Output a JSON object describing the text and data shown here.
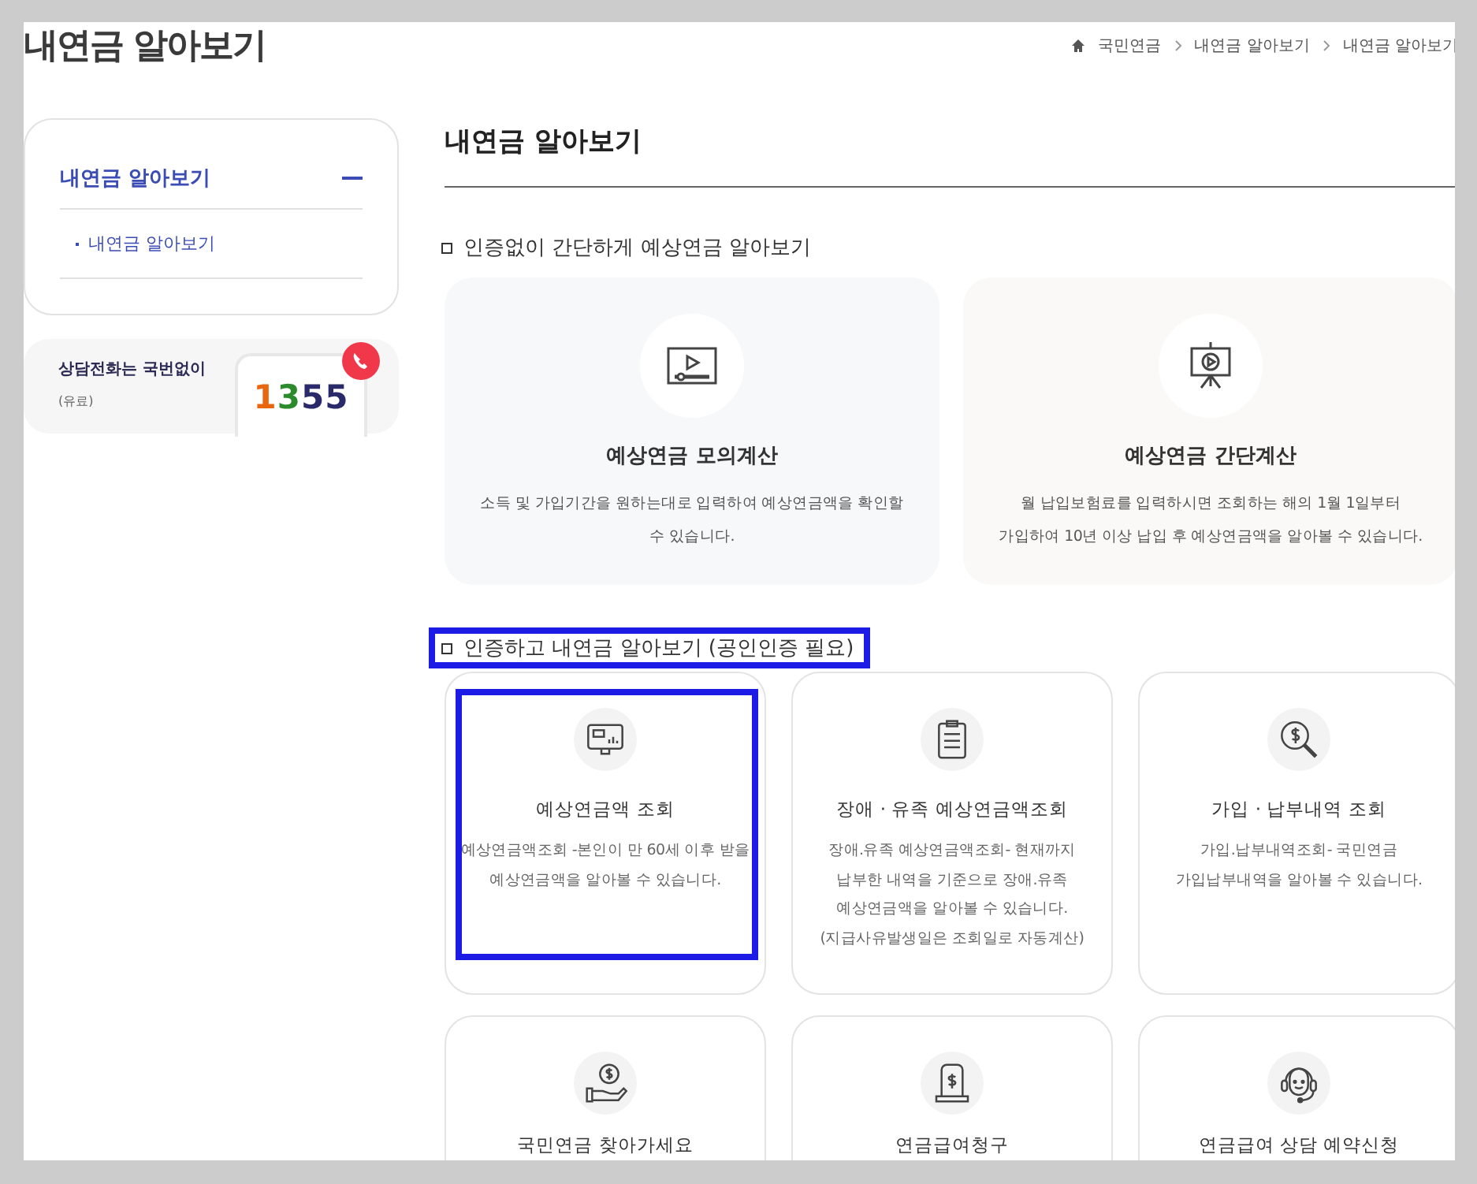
{
  "page_title": "내연금 알아보기",
  "breadcrumb": [
    "국민연금",
    "내연금 알아보기",
    "내연금 알아보기"
  ],
  "sidebar": {
    "menu": {
      "title": "내연금 알아보기",
      "expanded": true,
      "items": [
        {
          "label": "내연금 알아보기",
          "selected": true
        }
      ]
    },
    "phone_banner": {
      "text": "상담전화는 국번없이",
      "note": "(유료)",
      "number": "1355"
    }
  },
  "main": {
    "title": "내연금 알아보기",
    "sections": [
      {
        "heading": "인증없이 간단하게 예상연금 알아보기",
        "highlighted": false,
        "kind": "wide",
        "cards": [
          {
            "title": "예상연금 모의계산",
            "description": [
              "소득 및 가입기간을 원하는대로 입력하여 예상연금액을 확인할",
              "수 있습니다."
            ]
          },
          {
            "title": "예상연금 간단계산",
            "description": [
              "월 납입보험료를 입력하시면 조회하는 해의 1월 1일부터",
              "가입하여 10년 이상 납입 후 예상연금액을 알아볼 수 있습니다."
            ]
          }
        ]
      },
      {
        "heading": "인증하고 내연금 알아보기 (공인인증 필요)",
        "highlighted": true,
        "kind": "grid",
        "cards": [
          {
            "title": "예상연금액 조회",
            "description": [
              "예상연금액조회 -본인이 만 60세 이후 받을",
              "예상연금액을 알아볼 수 있습니다."
            ],
            "highlighted": true
          },
          {
            "title": "장애 · 유족 예상연금액조회",
            "description": [
              "장애.유족 예상연금액조회- 현재까지",
              "납부한 내역을 기준으로 장애.유족",
              "예상연금액을 알아볼 수 있습니다.",
              "(지급사유발생일은 조회일로 자동계산)"
            ],
            "highlighted": false
          },
          {
            "title": "가입 · 납부내역 조회",
            "description": [
              "가입.납부내역조회- 국민연금",
              "가입납부내역을 알아볼 수 있습니다."
            ],
            "highlighted": false
          },
          {
            "title": "국민연금 찾아가세요",
            "highlighted": false
          },
          {
            "title": "연금급여청구",
            "highlighted": false
          },
          {
            "title": "연금급여 상담 예약신청",
            "highlighted": false
          }
        ]
      }
    ]
  }
}
